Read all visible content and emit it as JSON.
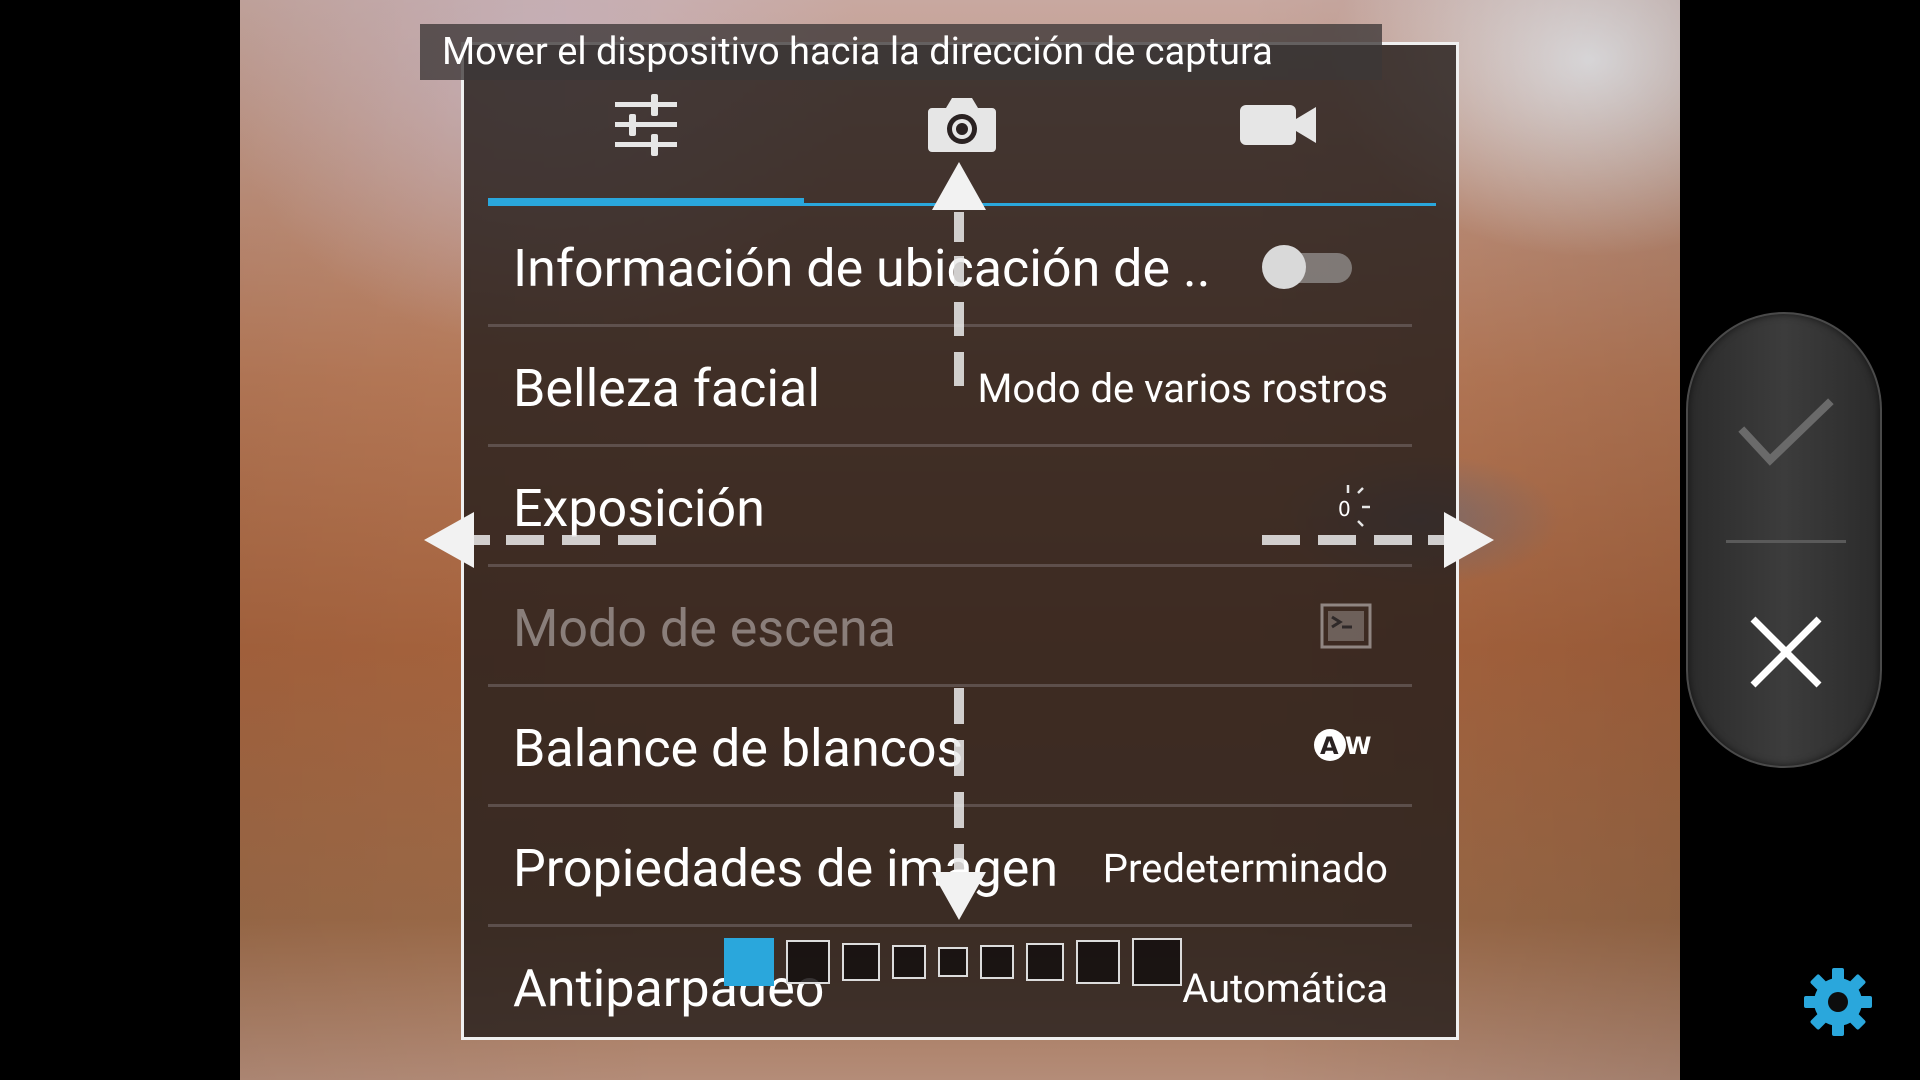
{
  "hint": {
    "text": "Mover el dispositivo hacia la dirección de captura"
  },
  "tabs": [
    {
      "icon": "sliders-icon",
      "active": true
    },
    {
      "icon": "camera-icon",
      "active": false
    },
    {
      "icon": "video-camera-icon",
      "active": false
    }
  ],
  "settings": [
    {
      "label": "Información de ubicación de ..",
      "value": "",
      "control": "toggle",
      "toggle_on": false
    },
    {
      "label": "Belleza facial",
      "value": "Modo de varios rostros"
    },
    {
      "label": "Exposición",
      "value": "",
      "control": "exposure-icon",
      "exposure_value": "0"
    },
    {
      "label": "Modo de escena",
      "value": "",
      "control": "scene-icon",
      "disabled": true
    },
    {
      "label": "Balance de blancos",
      "value": "",
      "control": "awb-icon",
      "awb_text": "AW"
    },
    {
      "label": "Propiedades de imagen",
      "value": "Predeterminado"
    },
    {
      "label": "Antiparpadeo",
      "value": "Automática"
    }
  ],
  "pager": {
    "count": 9,
    "active_index": 0
  },
  "side_controls": {
    "confirm_icon": "checkmark-icon",
    "cancel_icon": "close-icon"
  },
  "settings_button_icon": "gear-icon",
  "colors": {
    "accent": "#2aa7dc",
    "text": "#ffffff",
    "panel_bg": "rgba(38,30,28,0.82)"
  }
}
